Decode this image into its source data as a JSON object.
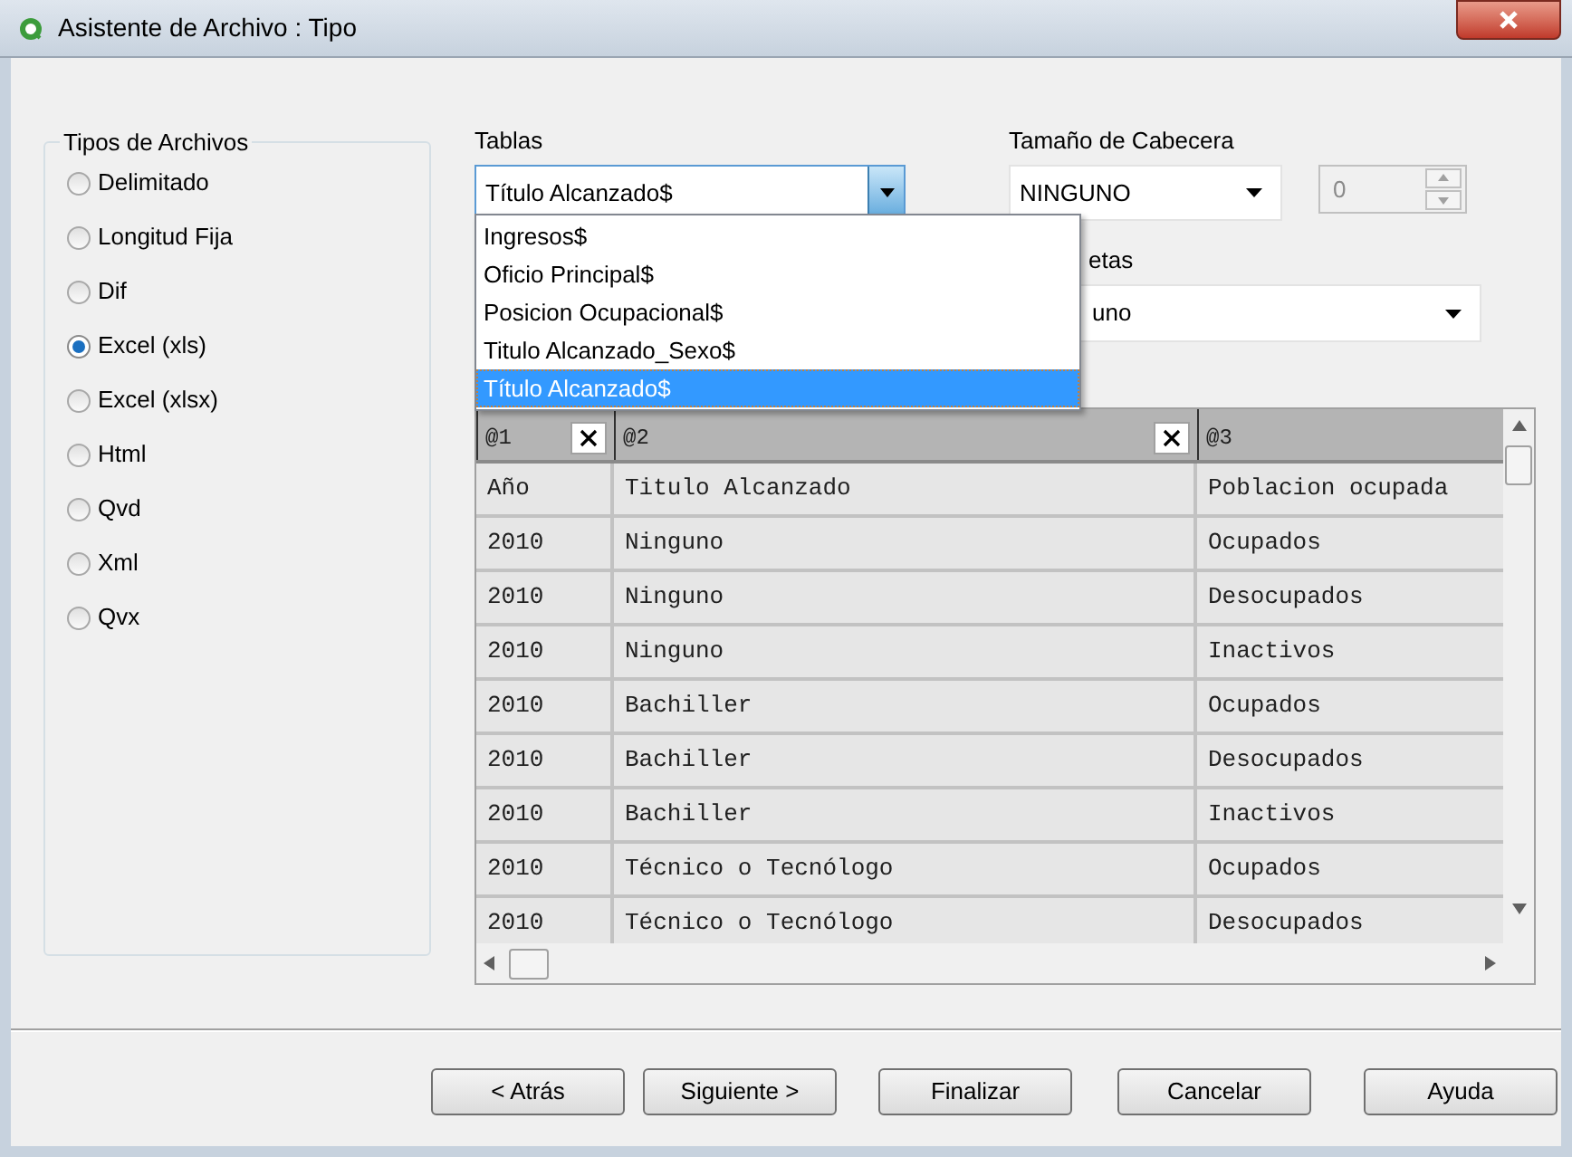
{
  "window": {
    "title": "Asistente de Archivo : Tipo"
  },
  "file_types": {
    "title": "Tipos de Archivos",
    "options": [
      {
        "label": "Delimitado",
        "selected": false
      },
      {
        "label": "Longitud Fija",
        "selected": false
      },
      {
        "label": "Dif",
        "selected": false
      },
      {
        "label": "Excel (xls)",
        "selected": true
      },
      {
        "label": "Excel (xlsx)",
        "selected": false
      },
      {
        "label": "Html",
        "selected": false
      },
      {
        "label": "Qvd",
        "selected": false
      },
      {
        "label": "Xml",
        "selected": false
      },
      {
        "label": "Qvx",
        "selected": false
      }
    ]
  },
  "tables": {
    "label": "Tablas",
    "value": "Título Alcanzado$",
    "expanded": true,
    "options": [
      {
        "label": "Ingresos$",
        "selected": false
      },
      {
        "label": "Oficio Principal$",
        "selected": false
      },
      {
        "label": "Posicion Ocupacional$",
        "selected": false
      },
      {
        "label": "Titulo Alcanzado_Sexo$",
        "selected": false
      },
      {
        "label": "Título Alcanzado$",
        "selected": true
      }
    ]
  },
  "header_size": {
    "label": "Tamaño de Cabecera",
    "value": "NINGUNO",
    "spin_value": "0"
  },
  "labels": {
    "label": "etas",
    "value": "uno"
  },
  "preview": {
    "columns": [
      "@1",
      "@2",
      "@3"
    ],
    "rows": [
      [
        "Año",
        "Titulo Alcanzado",
        "Poblacion ocupada"
      ],
      [
        "2010",
        "Ninguno",
        "Ocupados"
      ],
      [
        "2010",
        "Ninguno",
        "Desocupados"
      ],
      [
        "2010",
        "Ninguno",
        "Inactivos"
      ],
      [
        "2010",
        "Bachiller",
        "Ocupados"
      ],
      [
        "2010",
        "Bachiller",
        "Desocupados"
      ],
      [
        "2010",
        "Bachiller",
        "Inactivos"
      ],
      [
        "2010",
        "Técnico o Tecnólogo",
        "Ocupados"
      ],
      [
        "2010",
        "Técnico o Tecnólogo",
        "Desocupados"
      ]
    ]
  },
  "buttons": [
    "< Atrás",
    "Siguiente >",
    "Finalizar",
    "Cancelar",
    "Ayuda"
  ]
}
